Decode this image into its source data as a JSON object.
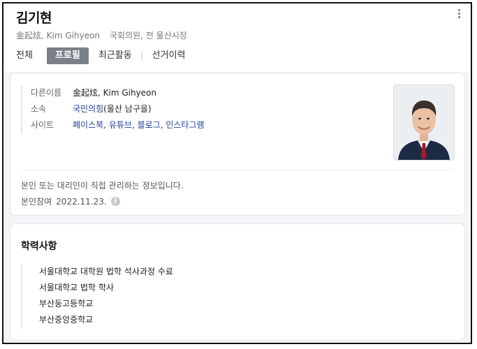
{
  "profile": {
    "name": "김기현",
    "subtitle_names": "金起炫, Kim Gihyeon",
    "subtitle_role": "국회의원, 전 울산시장"
  },
  "tabs": [
    "전체",
    "프로필",
    "최근활동",
    "선거이력"
  ],
  "active_tab": "프로필",
  "info": {
    "rows": [
      {
        "label": "다른이름",
        "value": "金起炫, Kim Gihyeon"
      },
      {
        "label": "소속",
        "party": "국민의힘",
        "detail": "(울산 남구을)"
      },
      {
        "label": "사이트",
        "links": [
          "페이스북",
          "유튜브",
          "블로그",
          "인스타그램"
        ]
      }
    ]
  },
  "notice": "본인 또는 대리인이 직접 관리하는 정보입니다.",
  "joined": {
    "label": "본인참여",
    "date": "2022.11.23."
  },
  "education": {
    "title": "학력사항",
    "items": [
      "서울대학교 대학원 법학 석사과정 수료",
      "서울대학교 법학 학사",
      "부산동고등학교",
      "부산중앙중학교"
    ]
  },
  "colors": {
    "link": "#1f3d99",
    "active_tab_bg": "#7b8088"
  },
  "icons": {
    "more": "more-vertical-icon",
    "info": "info-icon"
  }
}
